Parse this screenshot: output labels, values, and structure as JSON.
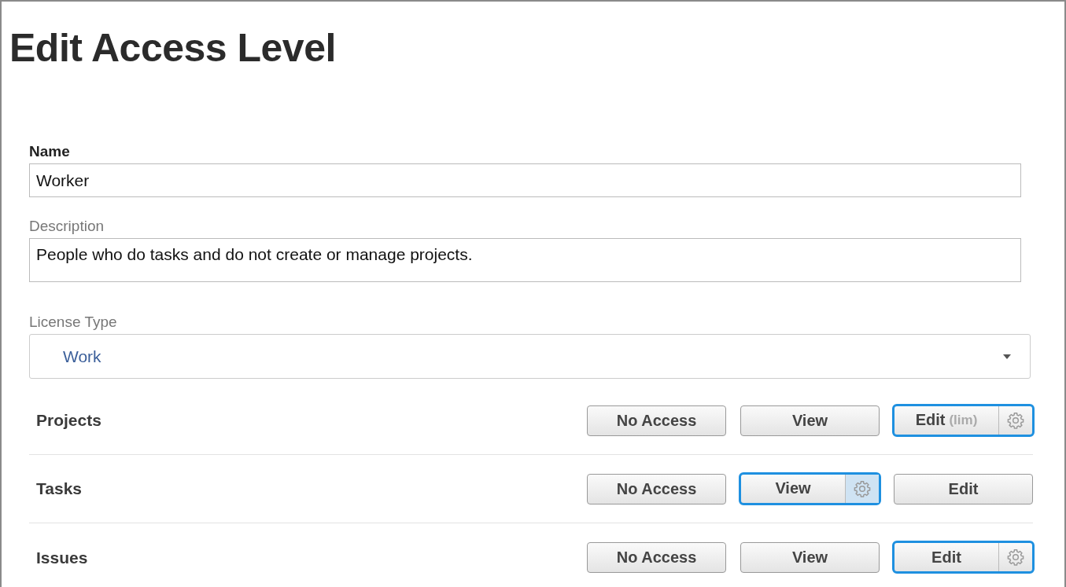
{
  "title": "Edit Access Level",
  "name_field": {
    "label": "Name",
    "value": "Worker"
  },
  "description_field": {
    "label": "Description",
    "value": "People who do tasks and do not create or manage projects."
  },
  "license_type": {
    "label": "License Type",
    "value": "Work"
  },
  "access_rows": [
    {
      "label": "Projects",
      "options": [
        {
          "label": "No Access",
          "selected": false
        },
        {
          "label": "View",
          "selected": false
        },
        {
          "label": "Edit",
          "note": "(lim)",
          "selected": true,
          "settings_active": false
        }
      ]
    },
    {
      "label": "Tasks",
      "options": [
        {
          "label": "No Access",
          "selected": false
        },
        {
          "label": "View",
          "selected": true,
          "settings_active": true
        },
        {
          "label": "Edit",
          "selected": false
        }
      ]
    },
    {
      "label": "Issues",
      "options": [
        {
          "label": "No Access",
          "selected": false
        },
        {
          "label": "View",
          "selected": false
        },
        {
          "label": "Edit",
          "selected": true,
          "settings_active": false
        }
      ]
    }
  ]
}
